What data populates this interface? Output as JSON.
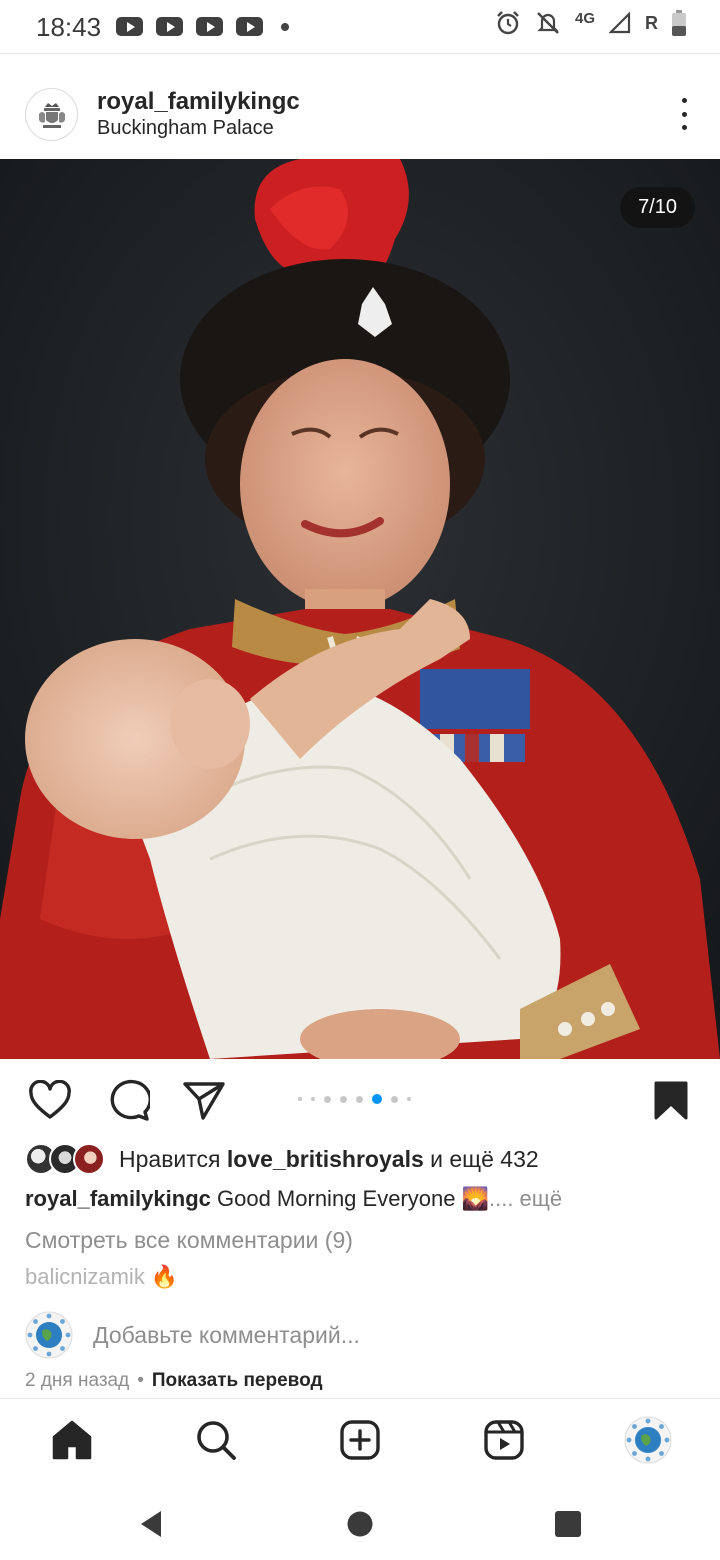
{
  "status_bar": {
    "time": "18:43",
    "network": "4G",
    "roaming": "R"
  },
  "post": {
    "username": "royal_familykingc",
    "location": "Buckingham Palace",
    "counter": "7/10",
    "carousel": {
      "total_dots": 8,
      "active_index": 5
    },
    "likes": {
      "prefix": "Нравится",
      "user": "love_britishroyals",
      "suffix": "и ещё 432"
    },
    "caption": {
      "username": "royal_familykingc",
      "text": "Good Morning Everyone 🌄",
      "more": ".... ещё"
    },
    "view_comments": "Смотреть все комментарии (9)",
    "comment_preview": "balicnizamik 🔥",
    "add_comment_placeholder": "Добавьте комментарий...",
    "time_ago": "2 дня назад",
    "show_translation": "Показать перевод"
  },
  "icons": {
    "like": "heart-icon",
    "comment": "comment-icon",
    "share": "send-icon",
    "save": "bookmark-icon",
    "nav": [
      "home-icon",
      "search-icon",
      "create-icon",
      "reels-icon",
      "profile-avatar"
    ]
  },
  "colors": {
    "text": "#262626",
    "muted": "#8e8e8e",
    "carousel_active": "#0095f6"
  }
}
